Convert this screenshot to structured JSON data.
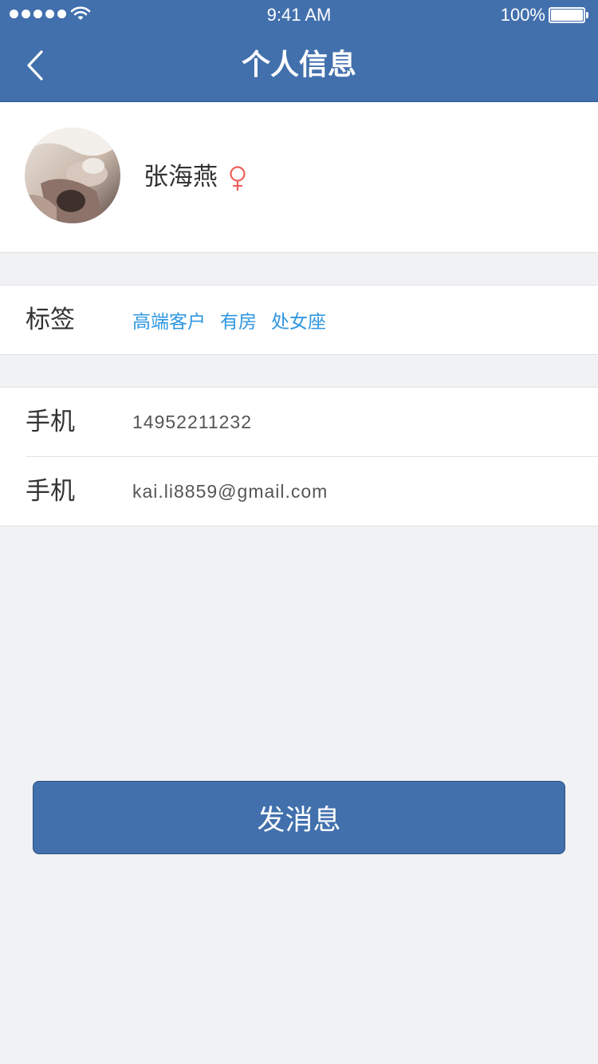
{
  "status_bar": {
    "time": "9:41 AM",
    "battery": "100%",
    "signal_icon": "signal-dots-icon",
    "wifi_icon": "wifi-icon",
    "battery_icon": "battery-icon",
    "battery_level": 1.0
  },
  "nav": {
    "title": "个人信息",
    "back_icon": "chevron-left-icon"
  },
  "profile": {
    "name": "张海燕",
    "gender_icon": "female-symbol-icon",
    "gender_color": "#f0605b"
  },
  "tags": {
    "label": "标签",
    "items": [
      "高端客户",
      "有房",
      "处女座"
    ],
    "color": "#2f97e0"
  },
  "contact": {
    "rows": [
      {
        "label": "手机",
        "value": "14952211232"
      },
      {
        "label": "手机",
        "value": "kai.li8859@gmail.com"
      }
    ]
  },
  "actions": {
    "send_label": "发消息"
  },
  "colors": {
    "primary": "#4270ad",
    "background": "#f1f2f4"
  }
}
